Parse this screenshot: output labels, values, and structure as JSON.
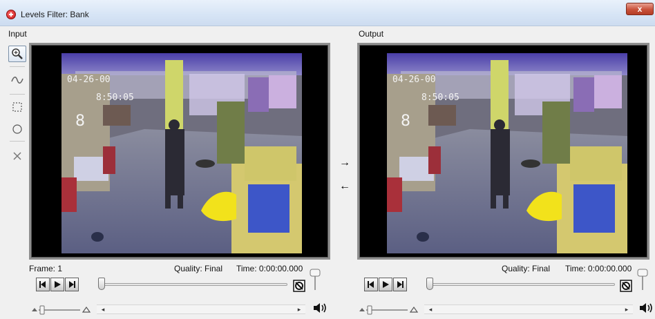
{
  "window": {
    "title": "Levels Filter: Bank",
    "close_symbol": "x"
  },
  "input": {
    "label": "Input",
    "frame_text": "Frame: 1",
    "quality_text": "Quality: Final",
    "time_text": "Time: 0:00:00.000",
    "overlay_date": "04-26-00",
    "overlay_time": "8:50:05",
    "scene_number": "8"
  },
  "output": {
    "label": "Output",
    "quality_text": "Quality: Final",
    "time_text": "Time: 0:00:00.000",
    "overlay_date": "04-26-00",
    "overlay_time": "8:50:05",
    "scene_number": "8"
  },
  "transfer": {
    "to_output": "→",
    "to_input": "←"
  },
  "tools": [
    "zoom-icon",
    "wave-icon",
    "rect-select-icon",
    "ellipse-select-icon",
    "clear-selection-icon"
  ],
  "colors": {
    "titlebar": "#d6e4f5",
    "close": "#c9523b",
    "frame_border": "#8f8f8f"
  }
}
